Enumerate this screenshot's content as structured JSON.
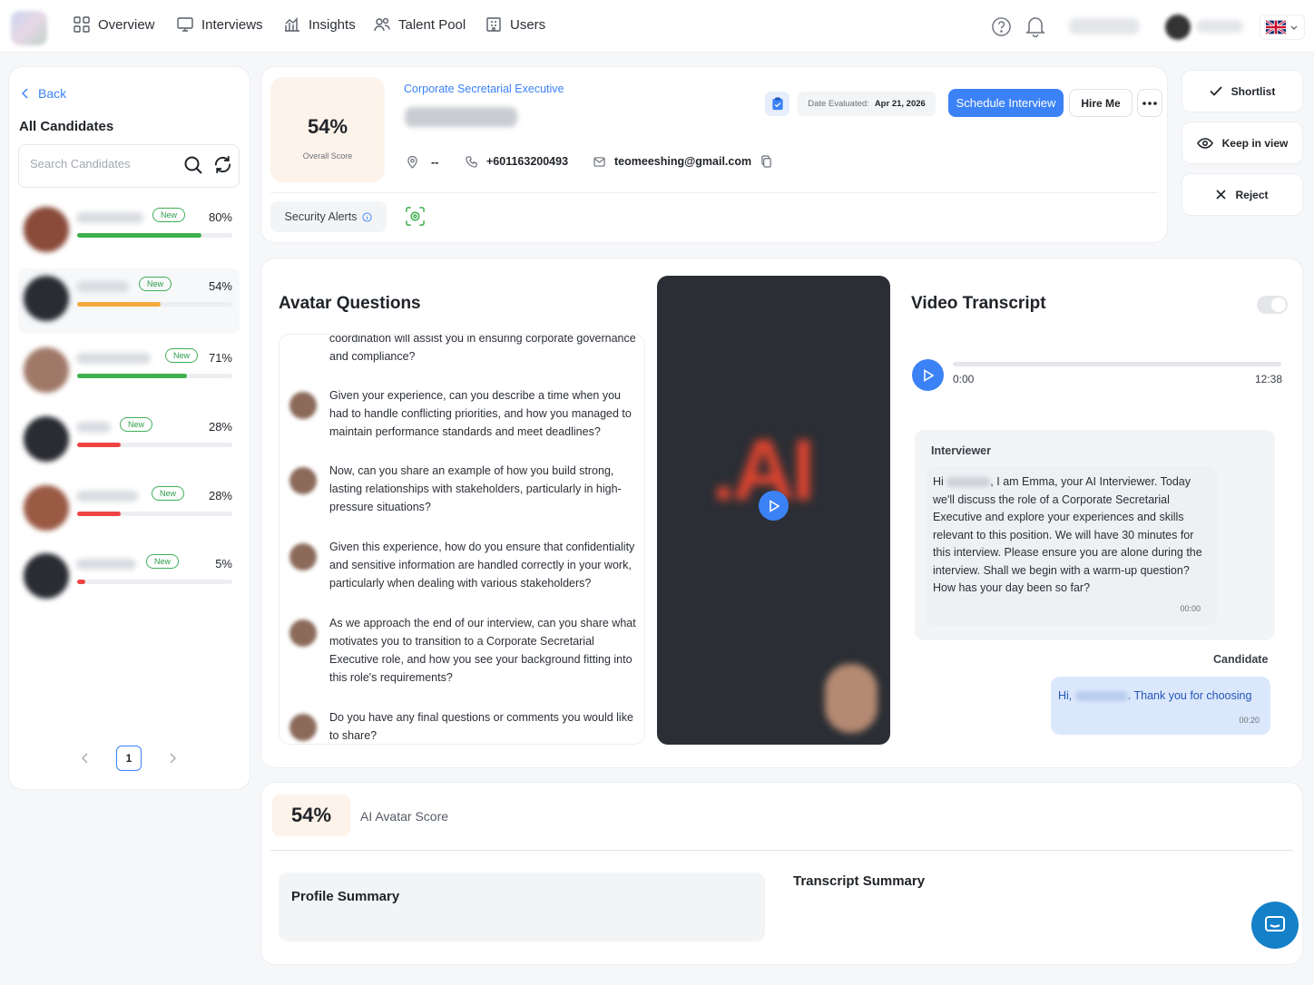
{
  "nav": {
    "items": [
      {
        "label": "Overview",
        "icon": "grid-icon"
      },
      {
        "label": "Interviews",
        "icon": "monitor-icon"
      },
      {
        "label": "Insights",
        "icon": "bar-chart-icon"
      },
      {
        "label": "Talent Pool",
        "icon": "users-icon"
      },
      {
        "label": "Users",
        "icon": "building-icon"
      }
    ]
  },
  "left": {
    "back_label": "Back",
    "title": "All Candidates",
    "search_placeholder": "Search Candidates",
    "candidates": [
      {
        "badge": "New",
        "score": "80%",
        "progress": 0.8,
        "color": "#3fb04f"
      },
      {
        "badge": "New",
        "score": "54%",
        "progress": 0.54,
        "color": "#f6a93b"
      },
      {
        "badge": "New",
        "score": "71%",
        "progress": 0.71,
        "color": "#3fb04f"
      },
      {
        "badge": "New",
        "score": "28%",
        "progress": 0.28,
        "color": "#ef4444"
      },
      {
        "badge": "New",
        "score": "28%",
        "progress": 0.28,
        "color": "#ef4444"
      },
      {
        "badge": "New",
        "score": "5%",
        "progress": 0.05,
        "color": "#ef4444"
      }
    ],
    "page": "1"
  },
  "header": {
    "overall_score": "54%",
    "overall_label": "Overall Score",
    "job_title": "Corporate Secretarial Executive",
    "location": "--",
    "phone": "+601163200493",
    "email": "teomeeshing@gmail.com",
    "date_label": "Date Evaluated:",
    "date_value": "Apr 21, 2026",
    "schedule_label": "Schedule Interview",
    "hire_label": "Hire Me",
    "security_label": "Security Alerts"
  },
  "actions": {
    "shortlist": "Shortlist",
    "keep": "Keep in view",
    "reject": "Reject"
  },
  "questions": {
    "title": "Avatar Questions",
    "partial": "coordination will assist you in ensuring corporate governance and compliance?",
    "items": [
      "Given your experience, can you describe a time when you had to handle conflicting priorities, and how you managed to maintain performance standards and meet deadlines?",
      "Now, can you share an example of how you build strong, lasting relationships with stakeholders, particularly in high-pressure situations?",
      "Given this experience, how do you ensure that confidentiality and sensitive information are handled correctly in your work, particularly when dealing with various stakeholders?",
      "As we approach the end of our interview, can you share what motivates you to transition to a Corporate Secretarial Executive role, and how you see your background fitting into this role's requirements?",
      "Do you have any final questions or comments you would like to share?"
    ]
  },
  "video": {
    "overlay_text": ".AI"
  },
  "transcript": {
    "title": "Video Transcript",
    "time_current": "0:00",
    "time_total": "12:38",
    "progress": 0,
    "interviewer_label": "Interviewer",
    "interviewer_text_a": "Hi",
    "interviewer_text_b": ", I am Emma, your AI Interviewer. Today we'll discuss the role of a Corporate Secretarial Executive and explore your experiences and skills relevant to this position. We will have 30 minutes for this interview. Please ensure you are alone during the interview. Shall we begin with a warm-up question? How has your day been so far?",
    "interviewer_time": "00:00",
    "candidate_label": "Candidate",
    "candidate_text_a": "Hi,",
    "candidate_text_b": ". Thank you for choosing",
    "candidate_time": "00:20"
  },
  "bottom": {
    "score": "54%",
    "score_label": "AI Avatar Score",
    "profile_summary": "Profile Summary",
    "transcript_summary": "Transcript Summary"
  },
  "colors": {
    "accent": "#3b82f6",
    "green": "#3fb04f",
    "orange": "#f6a93b",
    "red": "#ef4444",
    "video_bg": "#2b2e34",
    "chat_button": "#1480c8"
  }
}
